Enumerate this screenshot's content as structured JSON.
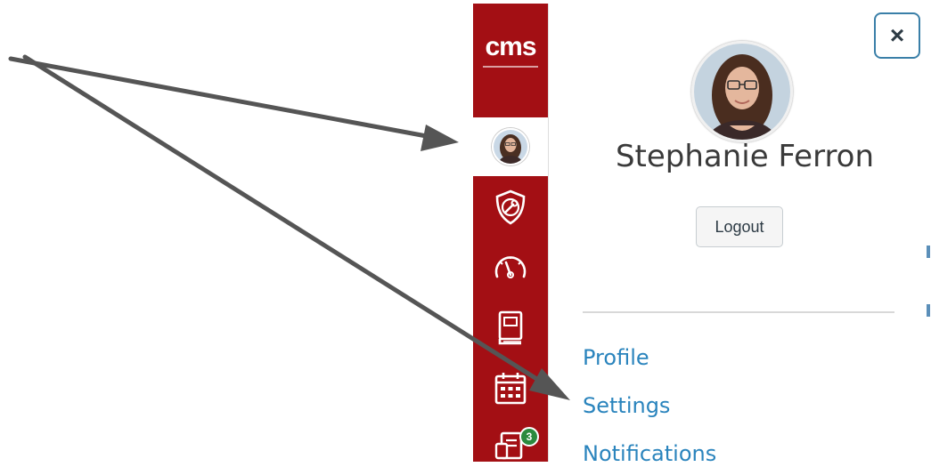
{
  "global_nav": {
    "logo_text": "cms",
    "items": [
      {
        "name": "account",
        "icon": "user-avatar"
      },
      {
        "name": "admin",
        "icon": "shield-wrench-icon"
      },
      {
        "name": "dashboard",
        "icon": "speedometer-icon"
      },
      {
        "name": "courses",
        "icon": "book-icon"
      },
      {
        "name": "calendar",
        "icon": "calendar-icon"
      },
      {
        "name": "inbox",
        "icon": "inbox-icon",
        "badge": "3"
      }
    ],
    "colors": {
      "background": "#a30f14",
      "active": "#ffffff",
      "badge": "#2b8a3e"
    }
  },
  "account_tray": {
    "close_label": "×",
    "user_name": "Stephanie Ferron",
    "logout_label": "Logout",
    "links": [
      {
        "label": "Profile"
      },
      {
        "label": "Settings"
      },
      {
        "label": "Notifications"
      }
    ],
    "link_color": "#2a84bd"
  },
  "annotation": {
    "arrow_color": "#555555",
    "arrows": [
      "account-avatar",
      "settings-link"
    ]
  }
}
